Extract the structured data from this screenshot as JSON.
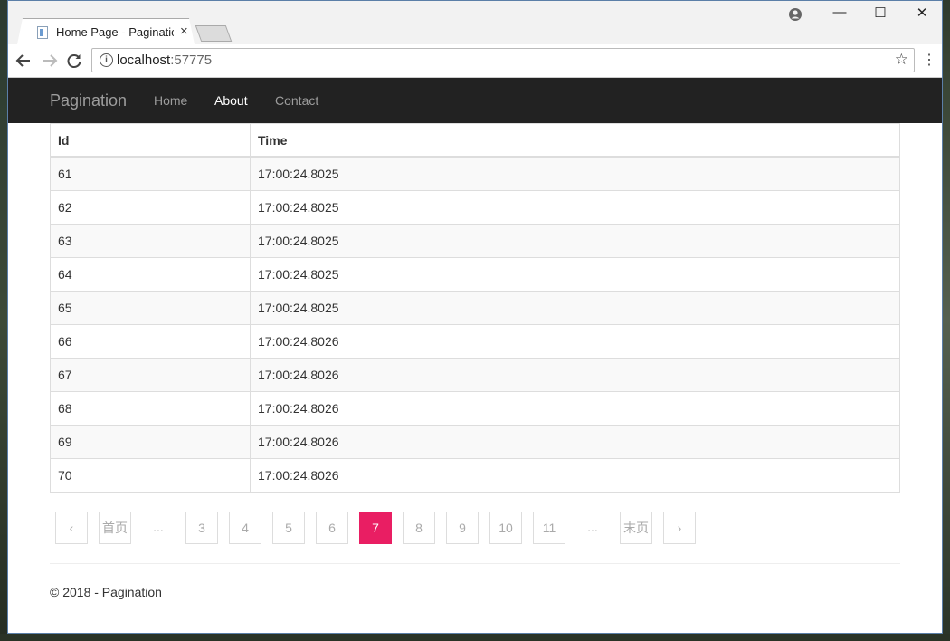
{
  "browser": {
    "tab_title": "Home Page - Paginatic",
    "tab_close": "×",
    "url_host": "localhost",
    "url_port": ":57775",
    "window_controls": {
      "minimize": "—",
      "maximize": "☐",
      "close": "✕"
    }
  },
  "navbar": {
    "brand": "Pagination",
    "links": [
      "Home",
      "About",
      "Contact"
    ],
    "active": "About"
  },
  "table": {
    "headers": [
      "Id",
      "Time"
    ],
    "rows": [
      [
        "61",
        "17:00:24.8025"
      ],
      [
        "62",
        "17:00:24.8025"
      ],
      [
        "63",
        "17:00:24.8025"
      ],
      [
        "64",
        "17:00:24.8025"
      ],
      [
        "65",
        "17:00:24.8025"
      ],
      [
        "66",
        "17:00:24.8026"
      ],
      [
        "67",
        "17:00:24.8026"
      ],
      [
        "68",
        "17:00:24.8026"
      ],
      [
        "69",
        "17:00:24.8026"
      ],
      [
        "70",
        "17:00:24.8026"
      ]
    ]
  },
  "pagination": {
    "prev": "‹",
    "first": "首页",
    "ellipsis": "...",
    "pages": [
      "3",
      "4",
      "5",
      "6",
      "7",
      "8",
      "9",
      "10",
      "11"
    ],
    "current": "7",
    "last": "末页",
    "next": "›"
  },
  "footer": {
    "text": "© 2018 - Pagination"
  },
  "colors": {
    "accent": "#e91e63",
    "navbar": "#222222"
  }
}
